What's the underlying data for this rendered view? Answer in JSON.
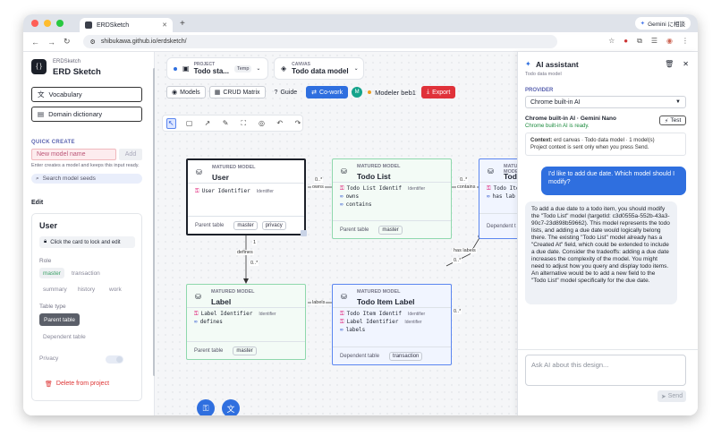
{
  "browser": {
    "tab_title": "ERDSketch",
    "new_tab": "+",
    "url": "shibukawa.github.io/erdsketch/",
    "gemini_label": "Gemini に相談"
  },
  "sidebar": {
    "brand_small": "ERDSketch",
    "brand": "ERD Sketch",
    "logo_glyph": "{ }",
    "vocabulary": "Vocabulary",
    "domain_dictionary": "Domain dictionary",
    "quick_create_label": "QUICK CREATE",
    "new_model_placeholder": "New model name",
    "add_label": "Add",
    "hint": "Enter creates a model and keeps this input ready.",
    "search_seeds": "Search model seeds",
    "edit_label": "Edit",
    "edit_card": {
      "title": "User",
      "lock_hint": "Click the card to lock and edit",
      "role_label": "Role",
      "roles": [
        "master",
        "transaction",
        "summary",
        "history",
        "work"
      ],
      "table_type_label": "Table type",
      "table_types": [
        "Parent table",
        "Dependent table"
      ],
      "privacy_label": "Privacy",
      "delete_label": "Delete from project"
    }
  },
  "canvas": {
    "project": {
      "label": "PROJECT",
      "name": "Todo sta...",
      "badge": "Temp"
    },
    "canvas_sel": {
      "label": "CANVAS",
      "name": "Todo data model"
    },
    "buttons": {
      "models": "Models",
      "crud": "CRUD Matrix",
      "guide": "Guide",
      "cowork": "Co-work",
      "avatar": "M",
      "modeler": "Modeler beb1",
      "export": "Export"
    },
    "models": [
      {
        "sub": "MATURED MODEL",
        "title": "User",
        "rows": [
          {
            "name": "User Identifier",
            "type": "Identifier"
          }
        ],
        "foot_label": "Parent table",
        "tags": [
          "master",
          "privacy"
        ]
      },
      {
        "sub": "MATURED MODEL",
        "title": "Todo List",
        "rows": [
          {
            "name": "Todo List Identif",
            "type": "Identifier"
          },
          {
            "name": "owns",
            "type": ""
          },
          {
            "name": "contains",
            "type": ""
          }
        ],
        "foot_label": "Parent table",
        "tags": [
          "master"
        ]
      },
      {
        "sub": "MATURED MODEL",
        "title": "Todo",
        "rows": [
          {
            "name": "Todo Ite",
            "type": ""
          },
          {
            "name": "has lab",
            "type": ""
          }
        ],
        "foot_label": "Dependent t",
        "tags": []
      },
      {
        "sub": "MATURED MODEL",
        "title": "Label",
        "rows": [
          {
            "name": "Label Identifier",
            "type": "Identifier"
          },
          {
            "name": "defines",
            "type": ""
          }
        ],
        "foot_label": "Parent table",
        "tags": [
          "master"
        ]
      },
      {
        "sub": "MATURED MODEL",
        "title": "Todo Item Label",
        "rows": [
          {
            "name": "Todo Item Identif",
            "type": "Identifier"
          },
          {
            "name": "Label Identifier",
            "type": "Identifier"
          },
          {
            "name": "labels",
            "type": ""
          }
        ],
        "foot_label": "Dependent table",
        "tags": [
          "transaction"
        ]
      }
    ],
    "edges": {
      "owns": "owns",
      "contains": "contains",
      "defines": "defines",
      "labels": "labels",
      "has_labels": "has labels",
      "one": "1",
      "many": "0..*"
    }
  },
  "ai": {
    "title": "AI assistant",
    "subtitle": "Todo data model",
    "provider_label": "PROVIDER",
    "provider": "Chrome built-in AI",
    "provider_name": "Chrome built-in AI · Gemini Nano",
    "provider_status": "Chrome built-in AI is ready.",
    "test": "Test",
    "context_label": "Context:",
    "context": "erd canvas · Todo data model · 1 model(s)",
    "context_note": "Project context is sent only when you press Send.",
    "user_message": "I'd like to add due date. Which model should I modify?",
    "ai_message": "To add a due date to a todo item, you should modify the \"Todo List\" model (targetId: c3d0555a-552b-43a3-90c7-23d898b59662). This model represents the todo lists, and adding a due date would logically belong there.  The existing \"Todo List\" model already has a \"Created At\" field, which could be extended to include a due date.  Consider the tradeoffs: adding a due date increases the complexity of the model. You might need to adjust how you query and display todo items.  An alternative would be to add a new field to the \"Todo List\" model specifically for the due date.",
    "ask_placeholder": "Ask AI about this design...",
    "send": "Send"
  },
  "colors": {
    "accent": "#2f6fdf",
    "export": "#e0323a",
    "user_card": "#1c2029",
    "green_card": "#8fd8ad",
    "blue_card": "#5b86f0"
  }
}
